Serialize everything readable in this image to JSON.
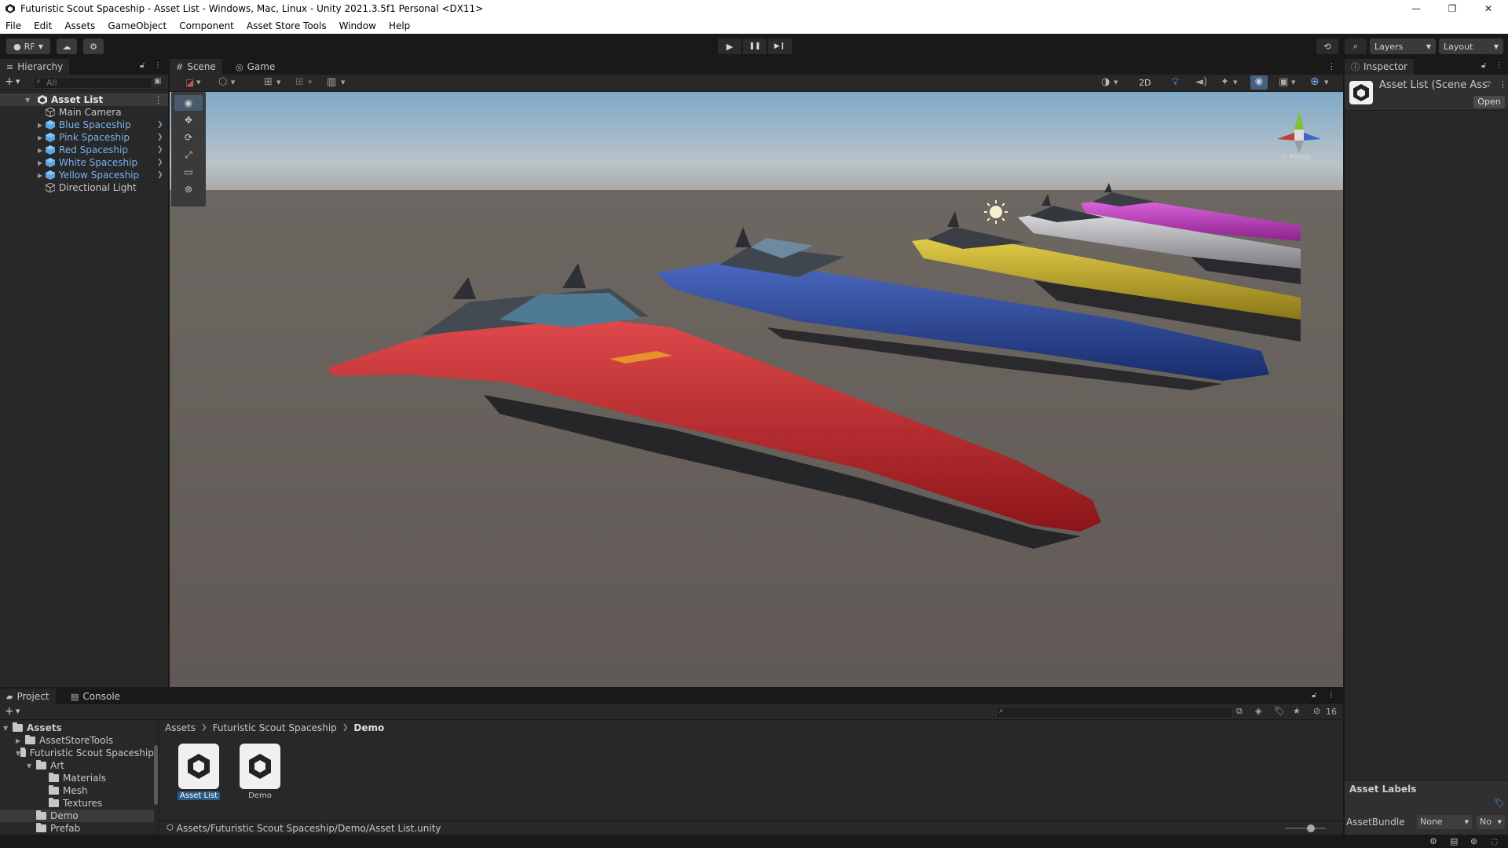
{
  "window": {
    "title": "Futuristic Scout Spaceship - Asset List - Windows, Mac, Linux - Unity 2021.3.5f1 Personal <DX11>",
    "controls": [
      "—",
      "❐",
      "✕"
    ]
  },
  "menu": [
    "File",
    "Edit",
    "Assets",
    "GameObject",
    "Component",
    "Asset Store Tools",
    "Window",
    "Help"
  ],
  "toolbar": {
    "account": "RF",
    "layers": "Layers",
    "layout": "Layout",
    "play": "▶",
    "pause": "❚❚",
    "step": "▶❙"
  },
  "hierarchy": {
    "tab": "Hierarchy",
    "search_placeholder": "All",
    "scene": "Asset List",
    "items": [
      {
        "label": "Main Camera",
        "prefab": false
      },
      {
        "label": "Blue Spaceship",
        "prefab": true
      },
      {
        "label": "Pink Spaceship",
        "prefab": true
      },
      {
        "label": "Red Spaceship",
        "prefab": true
      },
      {
        "label": "White Spaceship",
        "prefab": true
      },
      {
        "label": "Yellow Spaceship",
        "prefab": true
      },
      {
        "label": "Directional Light",
        "prefab": false
      }
    ]
  },
  "scene": {
    "tabs": [
      "Scene",
      "Game"
    ],
    "mode_2d": "2D",
    "gizmo_label": "< Persp",
    "tools": [
      "hand-tool",
      "move-tool",
      "rotate-tool",
      "scale-tool",
      "rect-tool",
      "transform-tool"
    ]
  },
  "inspector": {
    "tab": "Inspector",
    "object_name": "Asset List (Scene Asset)",
    "open_label": "Open",
    "asset_labels": "Asset Labels",
    "assetbundle_label": "AssetBundle",
    "assetbundle_value": "None",
    "assetbundle_variant": "No"
  },
  "project": {
    "tabs": [
      "Project",
      "Console"
    ],
    "hidden_count": "16",
    "tree": [
      {
        "label": "Assets",
        "bold": true
      },
      {
        "label": "AssetStoreTools"
      },
      {
        "label": "Futuristic Scout Spaceship"
      },
      {
        "label": "Art"
      },
      {
        "label": "Materials"
      },
      {
        "label": "Mesh"
      },
      {
        "label": "Textures"
      },
      {
        "label": "Demo"
      },
      {
        "label": "Prefab"
      }
    ],
    "breadcrumb": [
      "Assets",
      "Futuristic Scout Spaceship",
      "Demo"
    ],
    "assets": [
      {
        "label": "Asset List",
        "selected": true
      },
      {
        "label": "Demo",
        "selected": false
      }
    ],
    "path": "Assets/Futuristic Scout Spaceship/Demo/Asset List.unity"
  },
  "colors": {
    "ship_red": "#c8262a",
    "ship_blue": "#203c8c",
    "ship_yellow": "#c8b02a",
    "ship_white": "#b4b4b8",
    "ship_pink": "#c83ac8",
    "accent": "#3a79c3"
  }
}
